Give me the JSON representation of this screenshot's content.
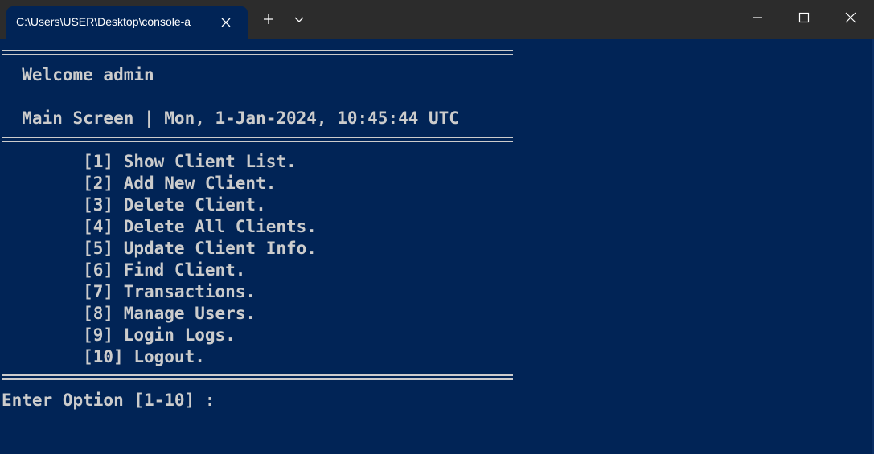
{
  "window": {
    "tab_title": "C:\\Users\\USER\\Desktop\\console-a",
    "icons": {
      "tab_close": "close-icon",
      "new_tab": "plus-icon",
      "dropdown": "chevron-down-icon",
      "minimize": "minimize-icon",
      "maximize": "maximize-icon",
      "close": "close-icon"
    }
  },
  "console": {
    "separator": "==========================================================",
    "welcome": "  Welcome admin",
    "screen_info": "  Main Screen | Mon, 1-Jan-2024, 10:45:44 UTC",
    "menu_items": [
      "        [1] Show Client List.",
      "        [2] Add New Client.",
      "        [3] Delete Client.",
      "        [4] Delete All Clients.",
      "        [5] Update Client Info.",
      "        [6] Find Client.",
      "        [7] Transactions.",
      "        [8] Manage Users.",
      "        [9] Login Logs.",
      "        [10] Logout."
    ],
    "prompt": "Enter Option [1-10] : "
  },
  "colors": {
    "background": "#012456",
    "text": "#cccccc",
    "titlebar": "#2c2c2c"
  }
}
